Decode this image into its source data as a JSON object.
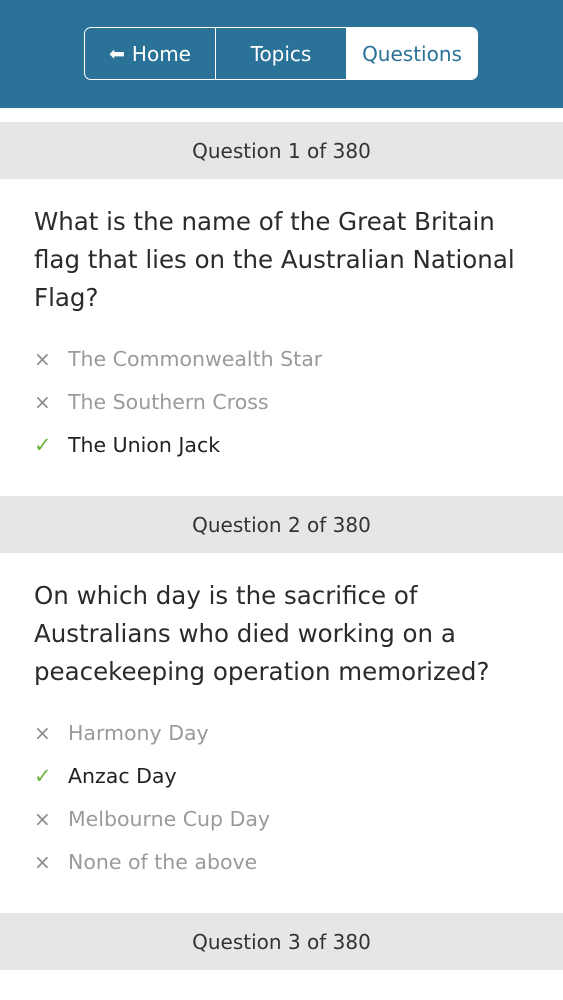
{
  "nav": {
    "home_label": "Home",
    "topics_label": "Topics",
    "questions_label": "Questions",
    "active": "Questions",
    "arrow_icon": "⬅"
  },
  "icons": {
    "wrong": "×",
    "correct": "✓"
  },
  "colors": {
    "header_bg": "#2a7298",
    "correct_mark": "#6cb33f",
    "question_header_bg": "#e6e6e8"
  },
  "questions": [
    {
      "header": "Question 1 of 380",
      "text": "What is the name of the Great Britain flag that lies on the Australian National Flag?",
      "answers": [
        {
          "label": "The Commonwealth Star",
          "correct": false
        },
        {
          "label": "The Southern Cross",
          "correct": false
        },
        {
          "label": "The Union Jack",
          "correct": true
        }
      ]
    },
    {
      "header": "Question 2 of 380",
      "text": "On which day is the sacrifice of Australians who died working on a peacekeeping operation memorized?",
      "answers": [
        {
          "label": "Harmony Day",
          "correct": false
        },
        {
          "label": "Anzac Day",
          "correct": true
        },
        {
          "label": "Melbourne Cup Day",
          "correct": false
        },
        {
          "label": "None of the above",
          "correct": false
        }
      ]
    },
    {
      "header": "Question 3 of 380"
    }
  ]
}
